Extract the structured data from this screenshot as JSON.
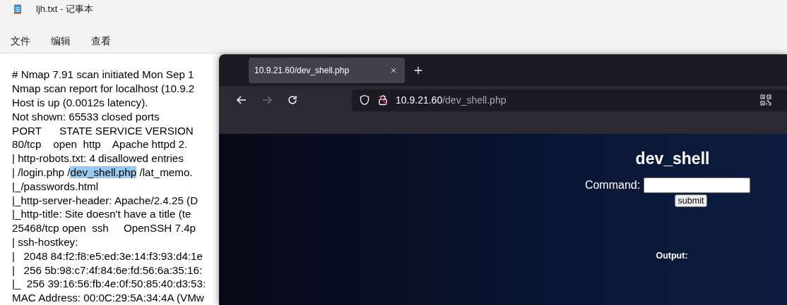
{
  "notepad": {
    "title": "ljh.txt - 记事本",
    "menu": [
      "文件",
      "编辑",
      "查看"
    ],
    "lines": [
      [
        {
          "text": "# Nmap 7.91 scan initiated Mon Sep 1",
          "selected": false
        }
      ],
      [
        {
          "text": "Nmap scan report for localhost (10.9.2",
          "selected": false
        }
      ],
      [
        {
          "text": "Host is up (0.0012s latency).",
          "selected": false
        }
      ],
      [
        {
          "text": "Not shown: 65533 closed ports",
          "selected": false
        }
      ],
      [
        {
          "text": "PORT      STATE SERVICE VERSION",
          "selected": false
        }
      ],
      [
        {
          "text": "80/tcp    open  http    Apache httpd 2.",
          "selected": false
        }
      ],
      [
        {
          "text": "| http-robots.txt: 4 disallowed entries",
          "selected": false
        }
      ],
      [
        {
          "text": "| /login.php /",
          "selected": false
        },
        {
          "text": "dev_shell.php",
          "selected": true
        },
        {
          "text": " /lat_memo.",
          "selected": false
        }
      ],
      [
        {
          "text": "|_/passwords.html",
          "selected": false
        }
      ],
      [
        {
          "text": "|_http-server-header: Apache/2.4.25 (D",
          "selected": false
        }
      ],
      [
        {
          "text": "|_http-title: Site doesn't have a title (te",
          "selected": false
        }
      ],
      [
        {
          "text": "25468/tcp open  ssh     OpenSSH 7.4p",
          "selected": false
        }
      ],
      [
        {
          "text": "| ssh-hostkey:",
          "selected": false
        }
      ],
      [
        {
          "text": "|   2048 84:f2:f8:e5:ed:3e:14:f3:93:d4:1e",
          "selected": false
        }
      ],
      [
        {
          "text": "|   256 5b:98:c7:4f:84:6e:fd:56:6a:35:16:",
          "selected": false
        }
      ],
      [
        {
          "text": "|_  256 39:16:56:fb:4e:0f:50:85:40:d3:53:",
          "selected": false
        }
      ],
      [
        {
          "text": "MAC Address: 00:0C:29:5A:34:4A (VMw",
          "selected": false
        }
      ]
    ]
  },
  "browser": {
    "tabs": [
      {
        "title": "10.9.21.60/dev_shell.php",
        "selected": true
      }
    ],
    "nav": {
      "back_disabled": false,
      "forward_disabled": true
    },
    "url": {
      "host": "10.9.21.60",
      "path": "/dev_shell.php"
    },
    "page": {
      "heading": "dev_shell",
      "command_label": "Command:",
      "submit": "submit",
      "output_label": "Output:"
    }
  }
}
